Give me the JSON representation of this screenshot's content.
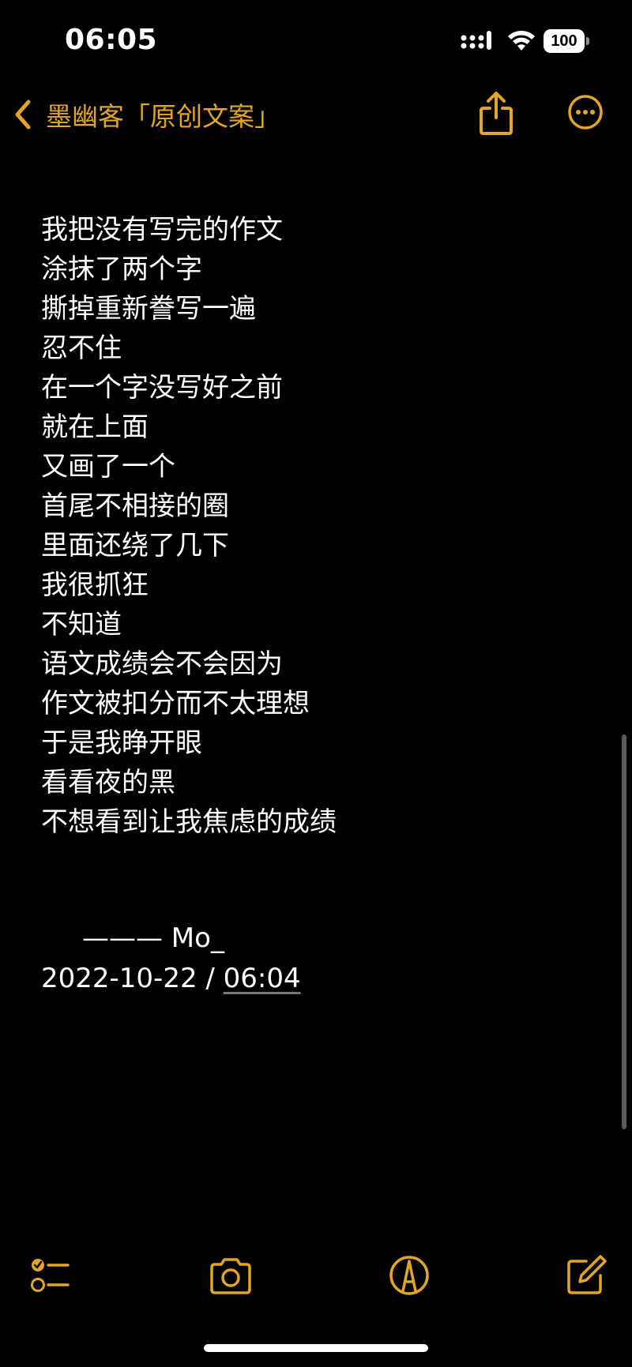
{
  "status_bar": {
    "time": "06:05",
    "battery": "100"
  },
  "nav": {
    "back_label": "墨幽客「原创文案」"
  },
  "note": {
    "lines": [
      "我把没有写完的作文",
      "涂抹了两个字",
      "撕掉重新誊写一遍",
      "忍不住",
      "在一个字没写好之前",
      "就在上面",
      "又画了一个",
      "首尾不相接的圈",
      "里面还绕了几下",
      "我很抓狂",
      "不知道",
      "语文成绩会不会因为",
      "作文被扣分而不太理想",
      "于是我睁开眼",
      "看看夜的黑",
      "不想看到让我焦虑的成绩"
    ],
    "signature": "——— Mo_",
    "date": "2022-10-22 / ",
    "time": "06:04"
  },
  "colors": {
    "accent": "#e3a623",
    "background": "#000000",
    "text": "#ffffff"
  },
  "icons": {
    "checklist": "checklist-icon",
    "camera": "camera-icon",
    "markup": "markup-icon",
    "compose": "compose-icon",
    "share": "share-icon",
    "more": "more-icon",
    "back": "chevron-left-icon"
  }
}
